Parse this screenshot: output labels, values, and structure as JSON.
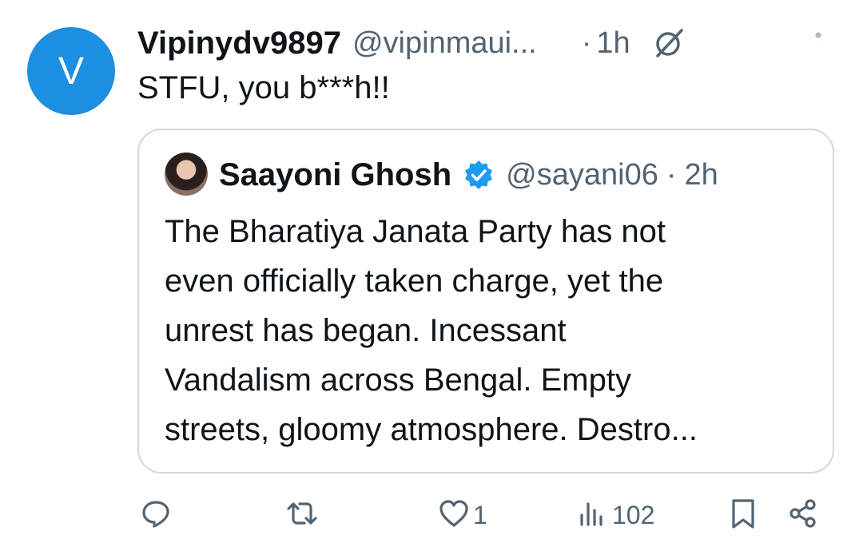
{
  "tweet": {
    "avatar_letter": "V",
    "display_name": "Vipinydv9897",
    "handle": "@vipinmaui...",
    "dot": "·",
    "time": "1h",
    "text": "STFU, you b***h!!"
  },
  "quote": {
    "display_name": "Saayoni Ghosh",
    "handle": "@sayani06",
    "dot": "·",
    "time": "2h",
    "lines": [
      "The Bharatiya Janata Party has not",
      "even officially taken charge, yet the",
      "unrest has began. Incessant",
      "Vandalism across Bengal. Empty",
      "streets, gloomy atmosphere. Destro..."
    ]
  },
  "actions": {
    "reply_count": "",
    "retweet_count": "",
    "like_count": "1",
    "views_count": "102"
  },
  "colors": {
    "avatar_bg": "#1d8fe0",
    "verified": "#1d9bf0",
    "secondary_text": "#536471",
    "border": "#cfd9de"
  }
}
